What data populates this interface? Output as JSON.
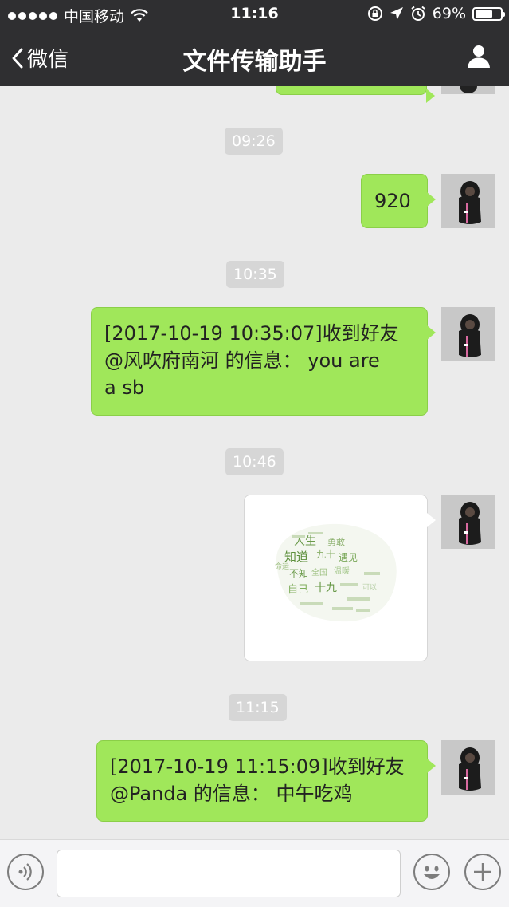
{
  "status_bar": {
    "carrier": "中国移动",
    "time": "11:16",
    "battery_percent": "69%",
    "battery_level": 0.69
  },
  "nav": {
    "back_label": "微信",
    "title": "文件传输助手"
  },
  "timestamps": [
    "09:26",
    "10:35",
    "10:46",
    "11:15"
  ],
  "messages": [
    {
      "type": "text",
      "lines": [
        "920"
      ]
    },
    {
      "type": "text",
      "lines": [
        "[2017-10-19 10:35:07]收到好友",
        "@风吹府南河 的信息： you are",
        "a sb"
      ]
    },
    {
      "type": "image",
      "description_words": [
        "人生",
        "知道",
        "九十",
        "遇见",
        "不知",
        "全国",
        "自己",
        "十九",
        "勇敢",
        "温暖",
        "命运",
        "可以"
      ]
    },
    {
      "type": "text",
      "lines": [
        "[2017-10-19 11:15:09]收到好友",
        "@Panda 的信息： 中午吃鸡"
      ]
    }
  ],
  "input": {
    "placeholder": ""
  },
  "colors": {
    "bar": "#2f2f31",
    "chat_bg": "#ebebeb",
    "bubble_green": "#a0e75a",
    "timestamp_bg": "#d6d6d6"
  },
  "icons": {
    "back": "chevron-left-icon",
    "contact": "person-icon",
    "voice": "voice-icon",
    "emoji": "emoji-icon",
    "add": "plus-icon"
  }
}
